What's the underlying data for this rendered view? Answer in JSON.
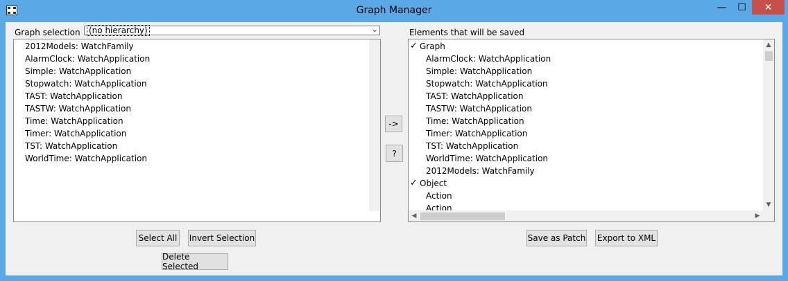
{
  "window": {
    "title": "Graph Manager",
    "minimize_glyph": "—",
    "maximize_glyph": "☐",
    "close_glyph": "✕"
  },
  "left": {
    "label": "Graph selection",
    "hierarchy_value": "(no hierarchy)",
    "items": [
      "2012Models: WatchFamily",
      "AlarmClock: WatchApplication",
      "Simple: WatchApplication",
      "Stopwatch: WatchApplication",
      "TAST: WatchApplication",
      "TASTW: WatchApplication",
      "Time: WatchApplication",
      "Timer: WatchApplication",
      "TST: WatchApplication",
      "WorldTime: WatchApplication"
    ]
  },
  "middle": {
    "move_label": "->",
    "help_label": "?"
  },
  "right": {
    "label": "Elements that will be saved",
    "tree": [
      {
        "text": "Graph",
        "level": 0,
        "checked": true
      },
      {
        "text": "AlarmClock: WatchApplication",
        "level": 1,
        "checked": false
      },
      {
        "text": "Simple: WatchApplication",
        "level": 1,
        "checked": false
      },
      {
        "text": "Stopwatch: WatchApplication",
        "level": 1,
        "checked": false
      },
      {
        "text": "TAST: WatchApplication",
        "level": 1,
        "checked": false
      },
      {
        "text": "TASTW: WatchApplication",
        "level": 1,
        "checked": false
      },
      {
        "text": "Time: WatchApplication",
        "level": 1,
        "checked": false
      },
      {
        "text": "Timer: WatchApplication",
        "level": 1,
        "checked": false
      },
      {
        "text": "TST: WatchApplication",
        "level": 1,
        "checked": false
      },
      {
        "text": "WorldTime: WatchApplication",
        "level": 1,
        "checked": false
      },
      {
        "text": "2012Models: WatchFamily",
        "level": 1,
        "checked": false
      },
      {
        "text": "Object",
        "level": 0,
        "checked": true
      },
      {
        "text": "Action",
        "level": 1,
        "checked": false
      },
      {
        "text": "Action",
        "level": 1,
        "checked": false
      }
    ]
  },
  "buttons": {
    "select_all": "Select All",
    "invert_selection": "Invert Selection",
    "delete_selected": "Delete Selected",
    "save_as_patch": "Save as Patch",
    "export_xml": "Export to XML"
  },
  "colors": {
    "titlebar": "#5aa9e6",
    "close": "#c7504a",
    "client": "#f0f0f0"
  }
}
